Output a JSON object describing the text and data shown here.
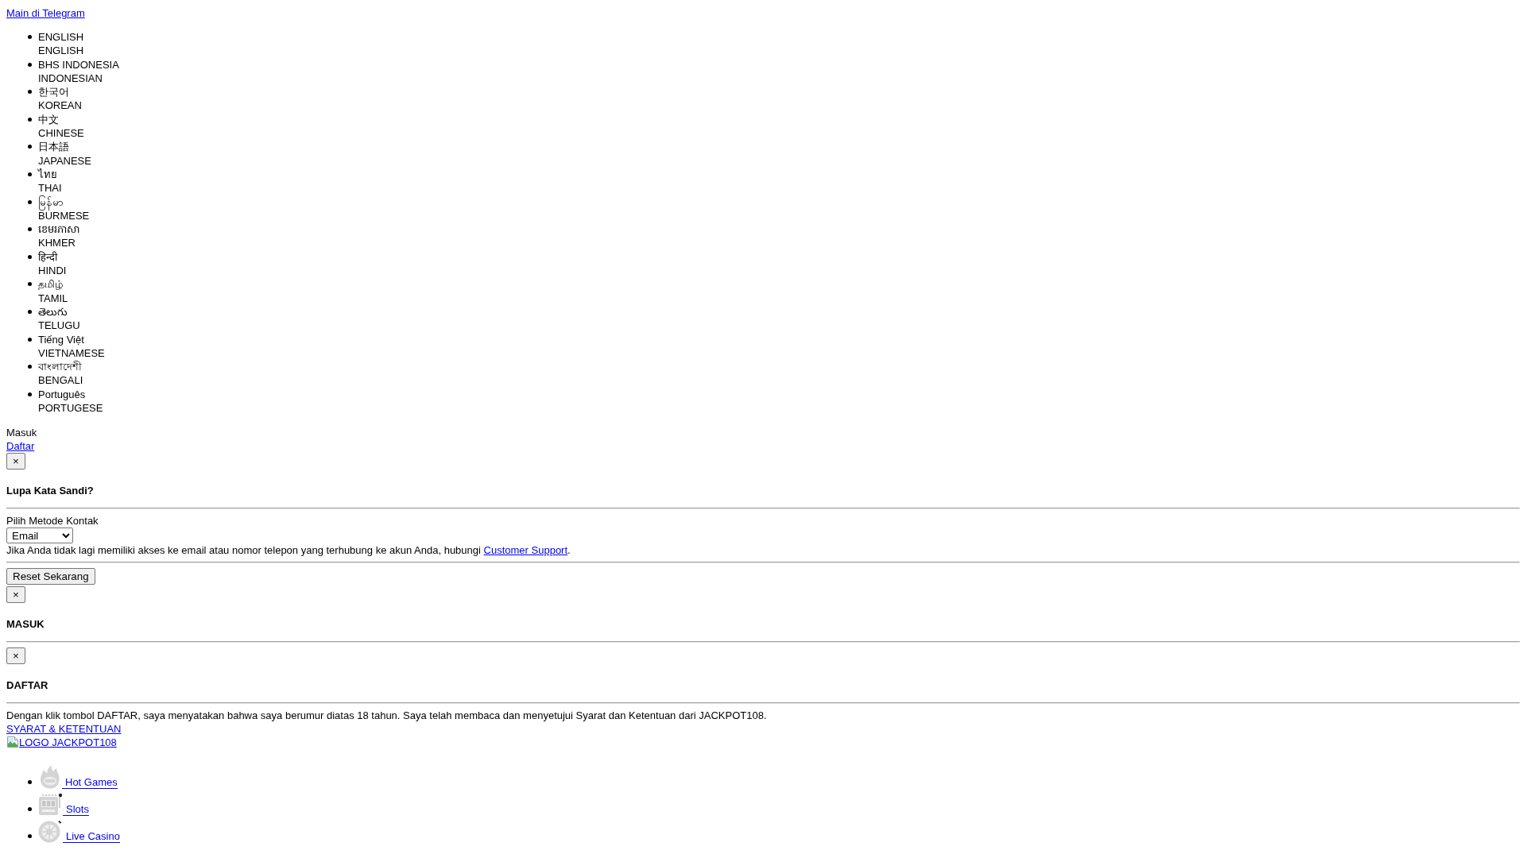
{
  "telegram_link": "Main di Telegram",
  "languages": [
    {
      "native": "ENGLISH",
      "name": "ENGLISH"
    },
    {
      "native": "BHS INDONESIA",
      "name": "INDONESIAN"
    },
    {
      "native": "한국어",
      "name": "KOREAN"
    },
    {
      "native": "中文",
      "name": "CHINESE"
    },
    {
      "native": "日本語",
      "name": "JAPANESE"
    },
    {
      "native": "ไทย",
      "name": "THAI"
    },
    {
      "native": "မြန်မာ",
      "name": "BURMESE"
    },
    {
      "native": "ខេមរភាសា",
      "name": "KHMER"
    },
    {
      "native": "हिन्दी",
      "name": "HINDI"
    },
    {
      "native": "தமிழ்",
      "name": "TAMIL"
    },
    {
      "native": "తెలుగు",
      "name": "TELUGU"
    },
    {
      "native": "Tiếng Việt",
      "name": "VIETNAMESE"
    },
    {
      "native": "বাংলাদেশী",
      "name": "BENGALI"
    },
    {
      "native": "Português",
      "name": "PORTUGESE"
    }
  ],
  "auth_tabs": [
    {
      "label": "Masuk",
      "selected": true
    },
    {
      "label": "Daftar",
      "selected": false
    }
  ],
  "modals": [
    {
      "kind": "forgot_password",
      "close": "×",
      "title": "Lupa Kata Sandi?",
      "contact_label": "Pilih Metode Kontak",
      "contact_method": "Email",
      "help": {
        "text": "Jika Anda tidak lagi memiliki akses ke email atau nomor telepon yang terhubung ke akun Anda, hubungi",
        "link": "Customer Support",
        "end": "."
      },
      "submit": "Reset Sekarang"
    },
    {
      "kind": "login",
      "close": "×",
      "title": "MASUK"
    },
    {
      "kind": "register",
      "close": "×",
      "title": "DAFTAR",
      "notice": "Dengan klik tombol DAFTAR, saya menyatakan bahwa saya berumur diatas 18 tahun. Saya telah membaca dan menyetujui Syarat dan Ketentuan dari JACKPOT108.",
      "terms_link": "SYARAT & KETENTUAN"
    }
  ],
  "logo_link": "LOGO JACKPOT108",
  "games": [
    {
      "kind": "hot",
      "label": "Hot Games"
    },
    {
      "kind": "slots",
      "label": "Slots"
    },
    {
      "kind": "casino",
      "label": "Live Casino"
    }
  ]
}
